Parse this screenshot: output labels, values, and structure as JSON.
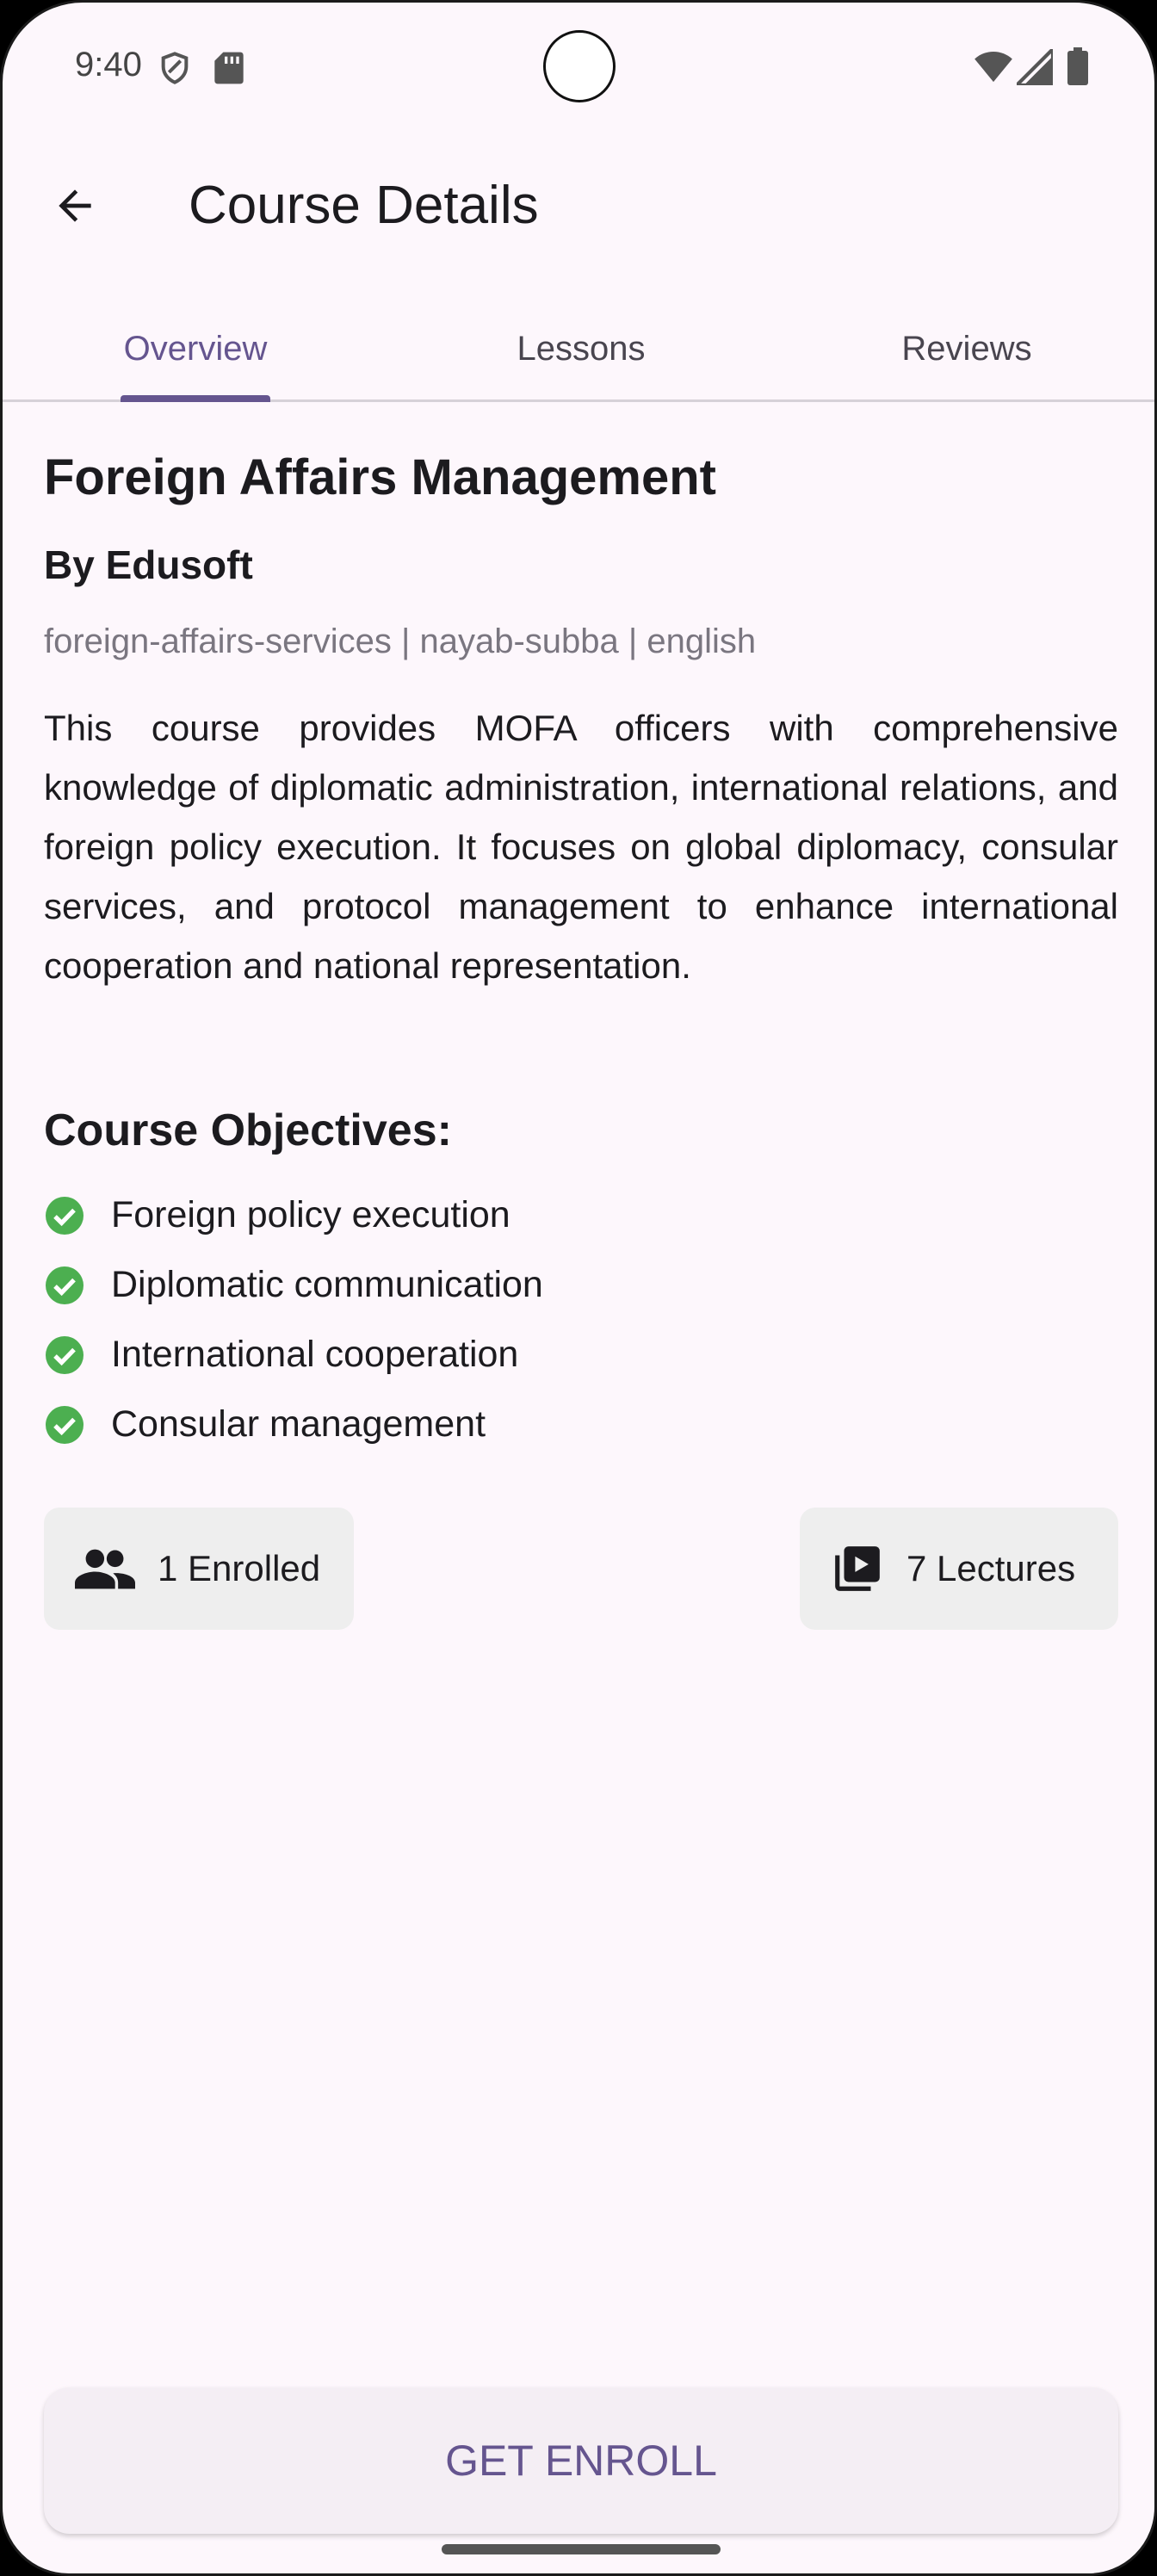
{
  "status_bar": {
    "time": "9:40"
  },
  "app_bar": {
    "title": "Course Details"
  },
  "tabs": [
    {
      "label": "Overview",
      "active": true
    },
    {
      "label": "Lessons",
      "active": false
    },
    {
      "label": "Reviews",
      "active": false
    }
  ],
  "course": {
    "title": "Foreign Affairs Management",
    "author": "By Edusoft",
    "tags": "foreign-affairs-services | nayab-subba | english",
    "description": "This course provides MOFA officers with comprehensive knowledge of diplomatic administration, international relations, and foreign policy execution. It focuses on global diplomacy, consular services, and protocol management to enhance international cooperation and national representation."
  },
  "objectives": {
    "heading": "Course Objectives:",
    "items": [
      "Foreign policy execution",
      "Diplomatic communication",
      "International cooperation",
      "Consular management"
    ]
  },
  "stats": {
    "enrolled": "1 Enrolled",
    "lectures": "7 Lectures"
  },
  "cta": {
    "label": "GET ENROLL"
  },
  "colors": {
    "accent": "#65558f",
    "check": "#4caf50",
    "background": "#fdf7fc"
  }
}
